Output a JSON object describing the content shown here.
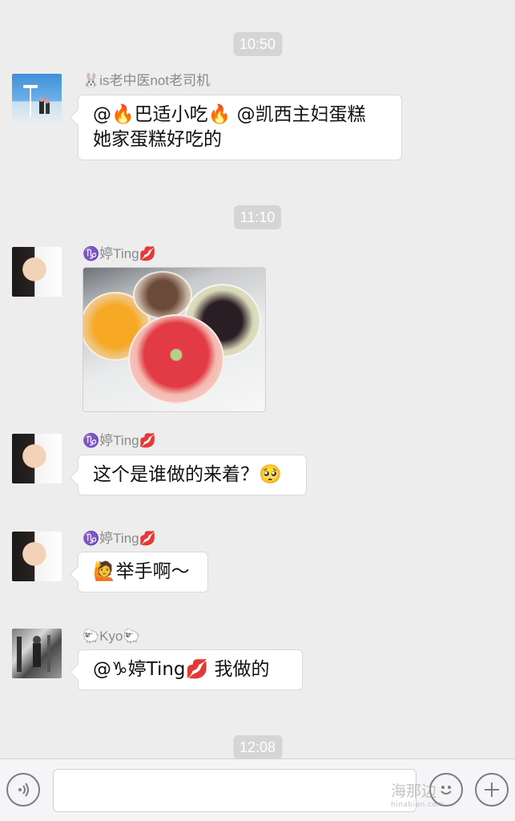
{
  "timestamps": [
    "10:50",
    "11:10",
    "12:08"
  ],
  "messages": [
    {
      "sender": "🐰is老中医not老司机",
      "text_line1": "@🔥巴适小吃🔥 @凯西主妇蛋糕",
      "text_line2": "她家蛋糕好吃的"
    },
    {
      "sender": "♑婷Ting💋",
      "image": "dessert cups photo"
    },
    {
      "sender": "♑婷Ting💋",
      "text": "这个是谁做的来着？🥺"
    },
    {
      "sender": "♑婷Ting💋",
      "text": "🙋举手啊～"
    },
    {
      "sender": "🐑Kyo🐑",
      "text": "@♑婷Ting💋 我做的"
    }
  ],
  "input_bar": {
    "voice_icon": "voice-icon",
    "emoji_icon": "emoji-icon",
    "plus_icon": "plus-icon",
    "input_value": ""
  },
  "watermark": {
    "text": "海那边",
    "sub": "hinabian.com"
  }
}
